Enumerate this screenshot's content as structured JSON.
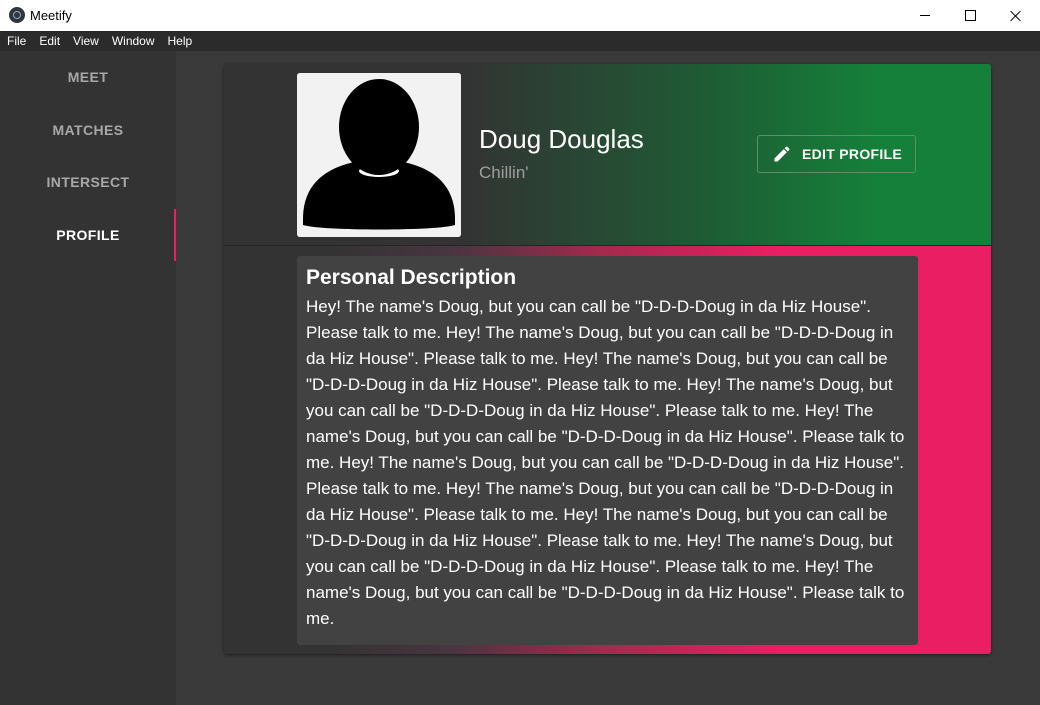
{
  "window": {
    "title": "Meetify"
  },
  "menu": [
    "File",
    "Edit",
    "View",
    "Window",
    "Help"
  ],
  "sidebar": {
    "items": [
      {
        "label": "MEET",
        "active": false
      },
      {
        "label": "MATCHES",
        "active": false
      },
      {
        "label": "INTERSECT",
        "active": false
      },
      {
        "label": "PROFILE",
        "active": true
      }
    ]
  },
  "profile": {
    "name": "Doug Douglas",
    "status": "Chillin'",
    "edit_label": "EDIT PROFILE",
    "avatar_icon": "person-silhouette-icon",
    "description_title": "Personal Description",
    "description": "Hey! The name's Doug, but you can call be \"D-D-D-Doug in da Hiz House\". Please talk to me. Hey! The name's Doug, but you can call be \"D-D-D-Doug in da Hiz House\". Please talk to me. Hey! The name's Doug, but you can call be \"D-D-D-Doug in da Hiz House\". Please talk to me. Hey! The name's Doug, but you can call be \"D-D-D-Doug in da Hiz House\". Please talk to me. Hey! The name's Doug, but you can call be \"D-D-D-Doug in da Hiz House\". Please talk to me. Hey! The name's Doug, but you can call be \"D-D-D-Doug in da Hiz House\". Please talk to me. Hey! The name's Doug, but you can call be \"D-D-D-Doug in da Hiz House\". Please talk to me. Hey! The name's Doug, but you can call be \"D-D-D-Doug in da Hiz House\". Please talk to me. Hey! The name's Doug, but you can call be \"D-D-D-Doug in da Hiz House\". Please talk to me. Hey! The name's Doug, but you can call be \"D-D-D-Doug in da Hiz House\". Please talk to me."
  },
  "colors": {
    "accent": "#e91e63",
    "header_green": "#15803a",
    "sidebar_bg": "#333333",
    "content_bg": "#3a3a3a",
    "card_bg": "#424242"
  }
}
